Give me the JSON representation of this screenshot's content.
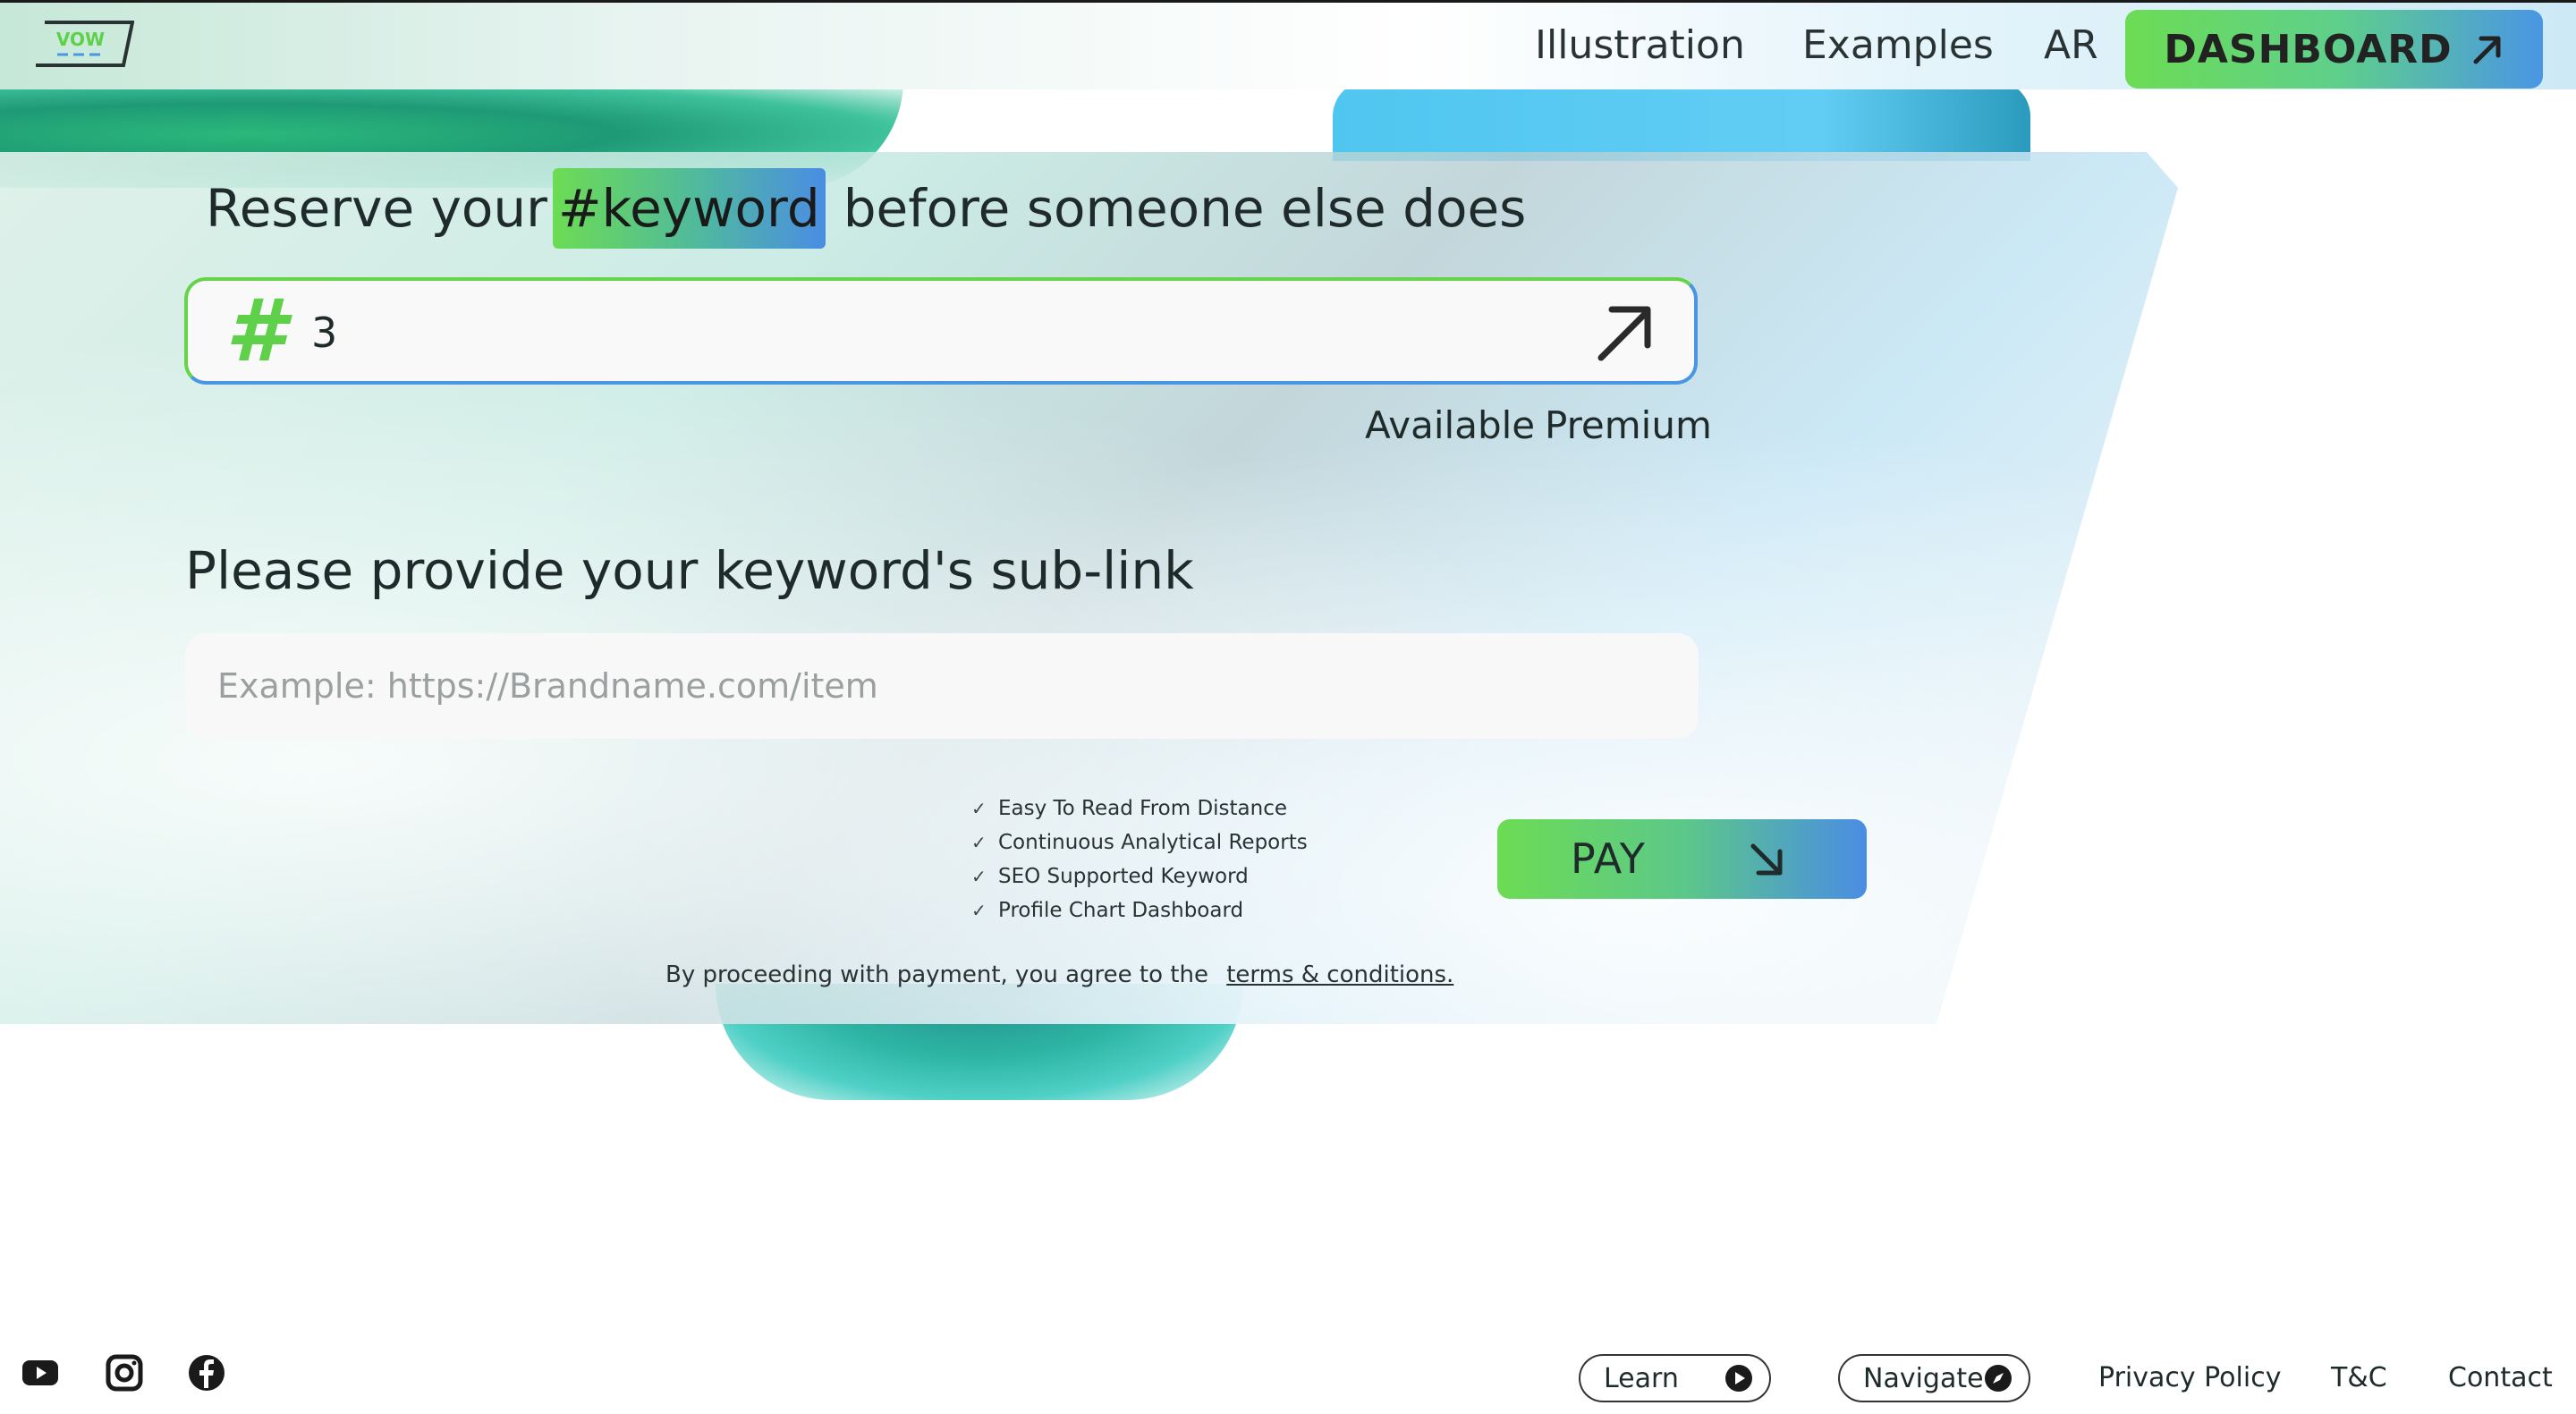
{
  "header": {
    "logo_text": "VOW",
    "nav": [
      "Illustration",
      "Examples",
      "AR"
    ],
    "dashboard_label": "DASHBOARD"
  },
  "headline": {
    "before": "Reserve your",
    "keyword": "#keyword",
    "after": "before someone else does"
  },
  "keyword_input": {
    "hash": "#",
    "value": "3"
  },
  "availability": {
    "available": "Available",
    "premium": "Premium"
  },
  "sublink": {
    "heading": "Please provide your keyword's sub-link",
    "placeholder": "Example: https://Brandname.com/item"
  },
  "features": [
    "Easy To Read From Distance",
    "Continuous Analytical Reports",
    "SEO Supported Keyword",
    "Profile Chart Dashboard"
  ],
  "pay_label": "PAY",
  "terms": {
    "text": "By proceeding with payment, you agree to the",
    "link": "terms & conditions."
  },
  "footer": {
    "social": [
      "youtube-icon",
      "instagram-icon",
      "facebook-icon"
    ],
    "learn": "Learn",
    "navigate": "Navigate",
    "links": [
      "Privacy Policy",
      "T&C",
      "Contact"
    ]
  },
  "colors": {
    "accent_green": "#6cdc54",
    "accent_blue": "#4a8de4"
  }
}
